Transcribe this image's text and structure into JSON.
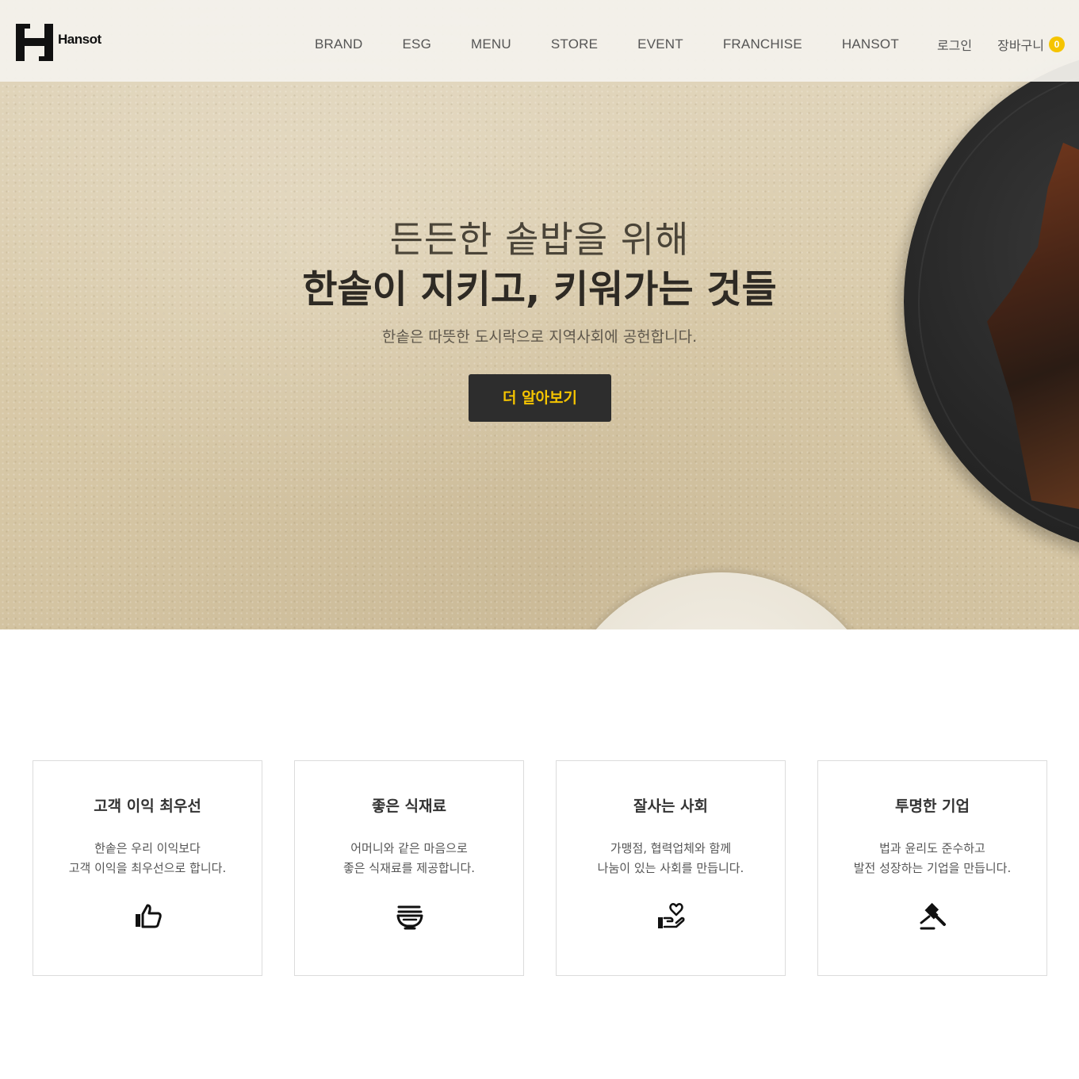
{
  "header": {
    "logo_text": "Hansot",
    "nav": [
      "BRAND",
      "ESG",
      "MENU",
      "STORE",
      "EVENT",
      "FRANCHISE",
      "HANSOT"
    ],
    "login_label": "로그인",
    "cart_label": "장바구니",
    "cart_count": "0"
  },
  "hero": {
    "line1": "든든한 솥밥을 위해",
    "line2": "한솥이 지키고, 키워가는 것들",
    "line3": "한솥은 따뜻한 도시락으로 지역사회에 공헌합니다.",
    "button_label": "더 알아보기"
  },
  "values": [
    {
      "title": "고객 이익 최우선",
      "desc": [
        "한솥은 우리 이익보다",
        "고객 이익을 최우선으로 합니다."
      ],
      "icon": "thumbs-up-icon"
    },
    {
      "title": "좋은 식재료",
      "desc": [
        "어머니와 같은 마음으로",
        "좋은 식재료를 제공합니다."
      ],
      "icon": "bowl-icon"
    },
    {
      "title": "잘사는 사회",
      "desc": [
        "가맹점, 협력업체와 함께",
        "나눔이 있는 사회를 만듭니다."
      ],
      "icon": "heart-hand-icon"
    },
    {
      "title": "투명한 기업",
      "desc": [
        "법과 윤리도 준수하고",
        "발전 성장하는 기업을 만듭니다."
      ],
      "icon": "gavel-icon"
    }
  ],
  "colors": {
    "accent": "#f5c400",
    "button_bg": "#2d2d2d",
    "text_dark": "#2e2a24"
  }
}
